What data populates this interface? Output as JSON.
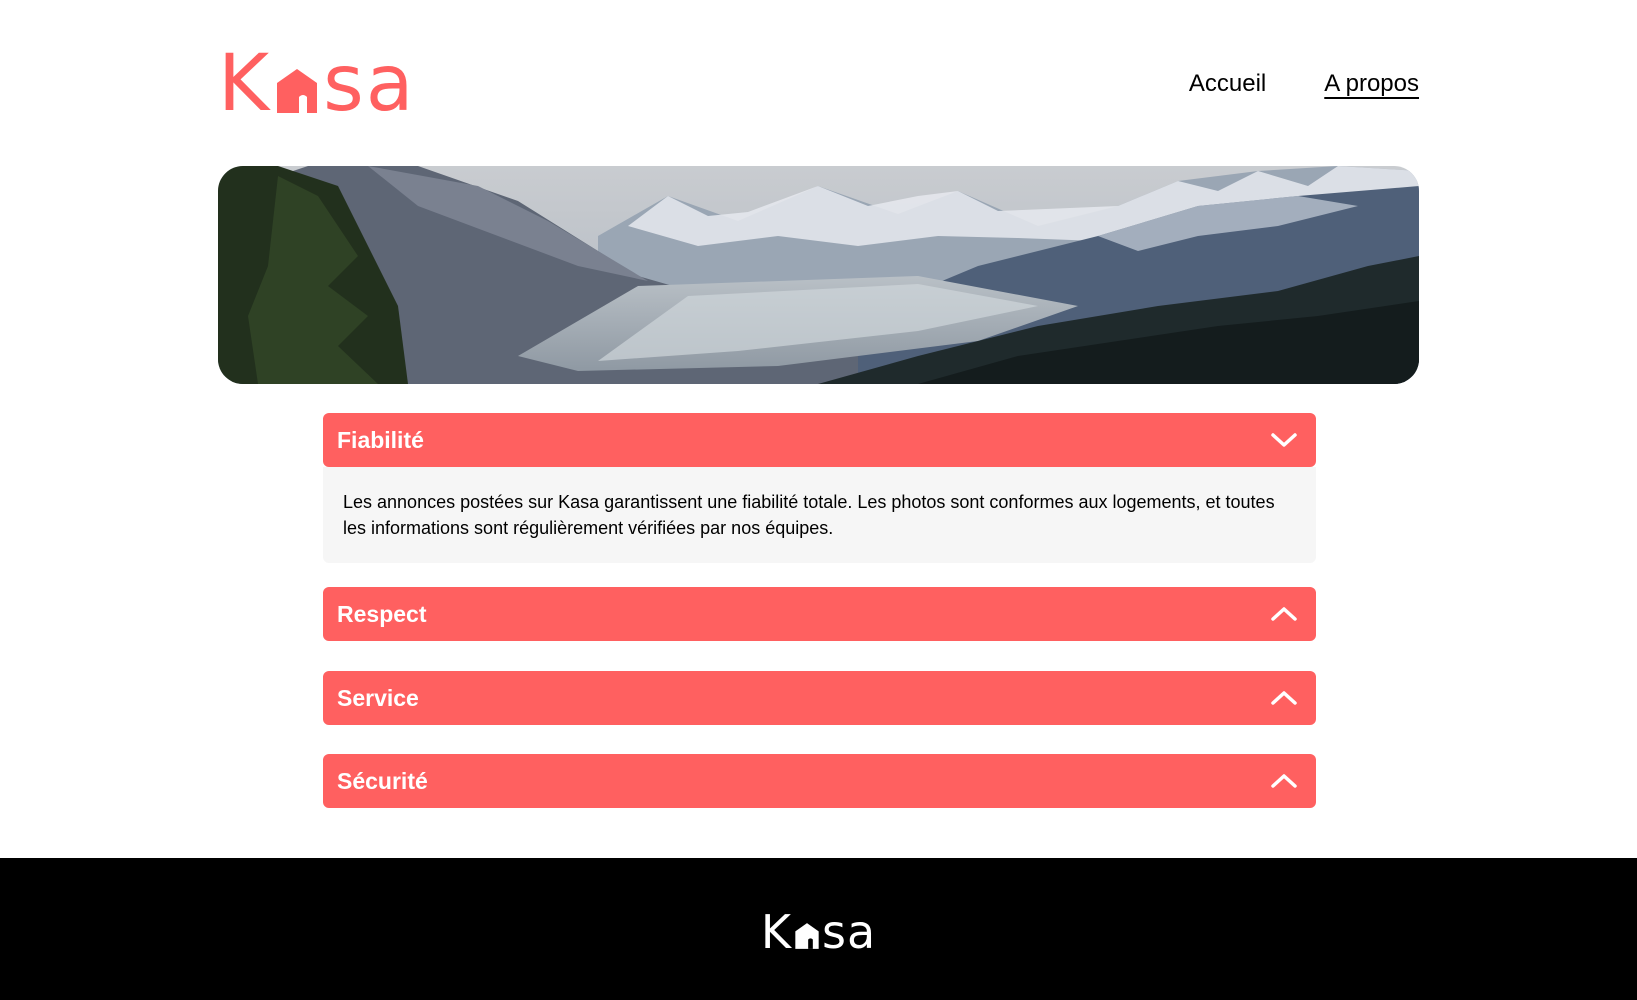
{
  "brand": {
    "logo_left": "K",
    "logo_right": "sa",
    "color": "#ff6060"
  },
  "nav": {
    "items": [
      {
        "label": "Accueil",
        "active": false
      },
      {
        "label": "A propos",
        "active": true
      }
    ]
  },
  "accordions": [
    {
      "title": "Fiabilité",
      "expanded": true,
      "chevron": "chevron-down-icon",
      "body": "Les annonces postées sur Kasa garantissent une fiabilité totale. Les photos sont conformes aux logements, et toutes les informations sont régulièrement vérifiées par nos équipes."
    },
    {
      "title": "Respect",
      "expanded": false,
      "chevron": "chevron-up-icon"
    },
    {
      "title": "Service",
      "expanded": false,
      "chevron": "chevron-up-icon"
    },
    {
      "title": "Sécurité",
      "expanded": false,
      "chevron": "chevron-up-icon"
    }
  ],
  "footer": {
    "logo_left": "K",
    "logo_right": "sa",
    "background": "#000000"
  }
}
